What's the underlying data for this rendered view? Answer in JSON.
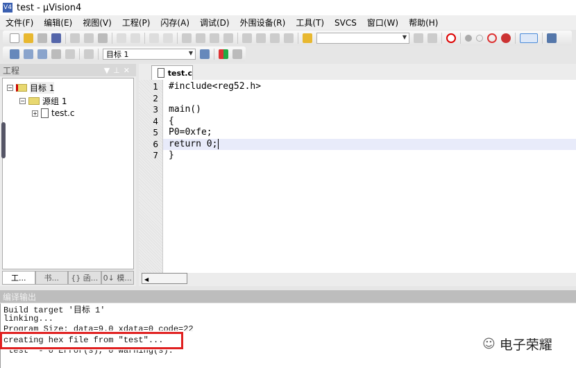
{
  "window": {
    "title": "test  - µVision4",
    "logo": "V4"
  },
  "menu": [
    "文件(F)",
    "编辑(E)",
    "视图(V)",
    "工程(P)",
    "闪存(A)",
    "调试(D)",
    "外围设备(R)",
    "工具(T)",
    "SVCS",
    "窗口(W)",
    "帮助(H)"
  ],
  "toolbar2": {
    "target_select": "目标 1"
  },
  "project_panel": {
    "title": "工程",
    "tree": [
      {
        "label": "目标 1"
      },
      {
        "label": "源组 1"
      },
      {
        "label": "test.c"
      }
    ],
    "tabs": [
      "工...",
      "书...",
      "{} 函...",
      "0↓ 模..."
    ]
  },
  "editor": {
    "tab": "test.c",
    "lines": [
      {
        "n": "1",
        "text": "#include<reg52.h>"
      },
      {
        "n": "2",
        "text": ""
      },
      {
        "n": "3",
        "text": "main()"
      },
      {
        "n": "4",
        "text": "{"
      },
      {
        "n": "5",
        "text": "P0=0xfe;"
      },
      {
        "n": "6",
        "text": "return 0;"
      },
      {
        "n": "7",
        "text": "}"
      }
    ]
  },
  "output": {
    "title": "编译输出",
    "lines": [
      "Build target '目标 1'",
      "linking...",
      "Program Size: data=9.0 xdata=0 code=22",
      "creating hex file from \"test\"...",
      "\"test\" - 0 Error(s), 0 Warning(s)."
    ],
    "highlight_color": "#e02020"
  },
  "watermark": "电子荣耀"
}
